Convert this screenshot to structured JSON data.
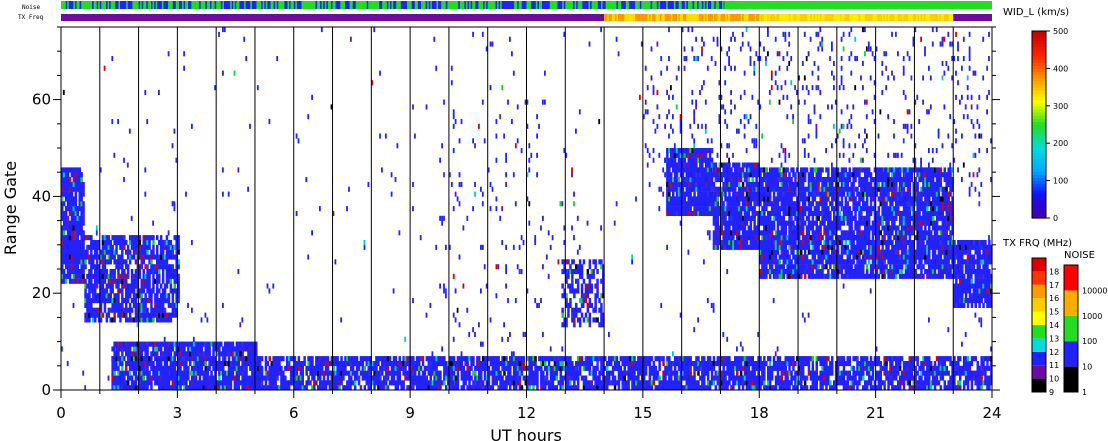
{
  "chart_data": {
    "type": "heatmap",
    "xlabel": "UT hours",
    "ylabel": "Range Gate",
    "xlim": [
      0,
      24
    ],
    "ylim": [
      0,
      75
    ],
    "x_ticks": [
      0,
      3,
      6,
      9,
      12,
      15,
      18,
      21,
      24
    ],
    "y_ticks": [
      0,
      20,
      40,
      60
    ],
    "hour_dividers": [
      1,
      2,
      3,
      4,
      5,
      6,
      7,
      8,
      9,
      10,
      11,
      12,
      13,
      14,
      15,
      16,
      17,
      18,
      19,
      20,
      21,
      22,
      23
    ],
    "echo_regions": [
      {
        "t0": 0.0,
        "t1": 0.6,
        "g0": 22,
        "g1": 46,
        "fill": 0.9
      },
      {
        "t0": 0.6,
        "t1": 3.0,
        "g0": 14,
        "g1": 32,
        "fill": 0.75
      },
      {
        "t0": 1.3,
        "t1": 5.0,
        "g0": 0,
        "g1": 10,
        "fill": 0.9
      },
      {
        "t0": 5.0,
        "t1": 24.0,
        "g0": 0,
        "g1": 7,
        "fill": 0.8
      },
      {
        "t0": 12.9,
        "t1": 14.0,
        "g0": 13,
        "g1": 27,
        "fill": 0.55
      },
      {
        "t0": 15.6,
        "t1": 16.8,
        "g0": 36,
        "g1": 50,
        "fill": 0.9
      },
      {
        "t0": 16.8,
        "t1": 18.0,
        "g0": 29,
        "g1": 47,
        "fill": 0.9
      },
      {
        "t0": 18.0,
        "t1": 23.0,
        "g0": 23,
        "g1": 46,
        "fill": 0.85
      },
      {
        "t0": 23.0,
        "t1": 24.0,
        "g0": 17,
        "g1": 31,
        "fill": 0.9
      }
    ],
    "scatter_regions": [
      {
        "t0": 0.0,
        "t1": 24.0,
        "g0": 0,
        "g1": 75,
        "density": 0.01
      },
      {
        "t0": 9.8,
        "t1": 13.5,
        "g0": 0,
        "g1": 60,
        "density": 0.03
      },
      {
        "t0": 15.0,
        "t1": 24.0,
        "g0": 40,
        "g1": 75,
        "density": 0.08
      }
    ],
    "noise_bar": {
      "label": "Noise",
      "segments": [
        {
          "t0": 0.0,
          "t1": 17.1,
          "pattern": "mixed",
          "colors": [
            "#22dd22",
            "#2222ff"
          ]
        },
        {
          "t0": 17.1,
          "t1": 24.0,
          "pattern": "solid",
          "colors": [
            "#22dd22"
          ]
        }
      ]
    },
    "tx_freq_bar": {
      "label": "TX Freq",
      "segments": [
        {
          "t0": 0.0,
          "t1": 14.0,
          "colors": [
            "#6a0da0"
          ]
        },
        {
          "t0": 14.0,
          "t1": 18.0,
          "colors": [
            "#ff9900",
            "#ffdd00"
          ]
        },
        {
          "t0": 18.0,
          "t1": 23.0,
          "colors": [
            "#ffee00",
            "#ffcc00"
          ]
        },
        {
          "t0": 23.0,
          "t1": 24.0,
          "colors": [
            "#6a0da0"
          ]
        }
      ]
    },
    "colorbar_width": {
      "title": "WID_L (km/s)",
      "range": [
        0,
        500
      ],
      "ticks": [
        "0",
        "100",
        "200",
        "300",
        "400",
        "500"
      ]
    },
    "colorbar_txfreq": {
      "title": "TX FRQ (MHz)",
      "ticks": [
        "9",
        "10",
        "11",
        "12",
        "13",
        "14",
        "15",
        "16",
        "17",
        "18"
      ],
      "colors": [
        "#000000",
        "#6a0da0",
        "#2222ff",
        "#00dddd",
        "#22dd22",
        "#ffff00",
        "#ffcc00",
        "#ff9900",
        "#ff3300",
        "#dd0000"
      ]
    },
    "colorbar_noise": {
      "title": "NOISE",
      "ticks": [
        "1",
        "10",
        "100",
        "1000",
        "10000"
      ],
      "colors": [
        "#000000",
        "#2222ff",
        "#22dd22",
        "#ffaa00",
        "#ff0000"
      ]
    },
    "colors": {
      "echo_primary": "#2222ff",
      "echo_secondary": [
        "#2222ff",
        "#3333ee",
        "#1f1fd8",
        "#5a1fb0",
        "#00cccc",
        "#22cc22",
        "#dd0000",
        "#000000"
      ]
    }
  }
}
